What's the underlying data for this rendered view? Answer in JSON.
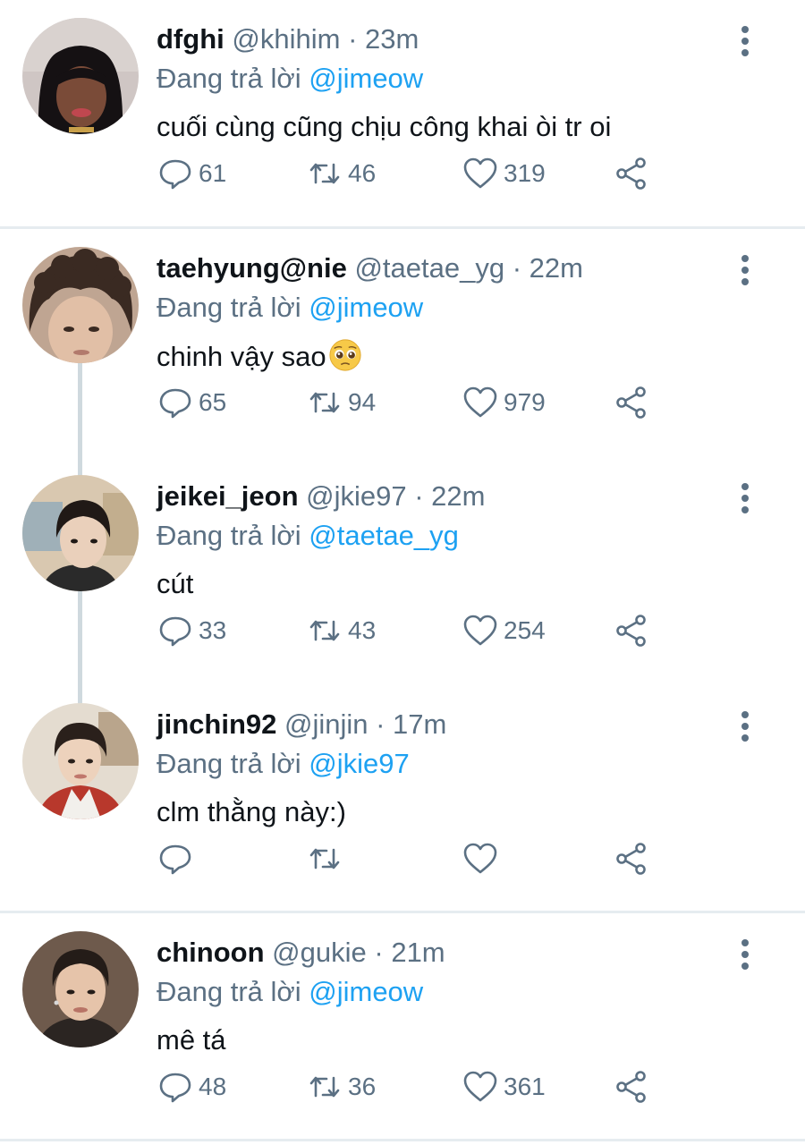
{
  "reply_prefix": "Đang trả lời",
  "colors": {
    "name": "#0f1419",
    "meta": "#5b7083",
    "mention": "#1da1f2",
    "thread_line": "#cfd9de",
    "separator": "#e6ecf0"
  },
  "tweets": [
    {
      "name": "dfghi",
      "handle": "@khihim",
      "time": "· 23m",
      "reply_to": "@jimeow",
      "text": "cuối cùng cũng chịu công khai òi tr oi",
      "replies": "61",
      "retweets": "46",
      "likes": "319"
    },
    {
      "name": "taehyung@nie",
      "handle": "@taetae_yg",
      "time": "· 22m",
      "reply_to": "@jimeow",
      "text": "chinh vậy sao",
      "emoji": "pleading-face-emoji",
      "replies": "65",
      "retweets": "94",
      "likes": "979"
    },
    {
      "name": "jeikei_jeon",
      "handle": "@jkie97",
      "time": "· 22m",
      "reply_to": "@taetae_yg",
      "text": "cút",
      "replies": "33",
      "retweets": "43",
      "likes": "254"
    },
    {
      "name": "jinchin92",
      "handle": "@jinjin",
      "time": "· 17m",
      "reply_to": "@jkie97",
      "text": "clm thằng này:)",
      "replies": "",
      "retweets": "",
      "likes": ""
    },
    {
      "name": "chinoon",
      "handle": "@gukie",
      "time": "· 21m",
      "reply_to": "@jimeow",
      "text": "mê tá",
      "replies": "48",
      "retweets": "36",
      "likes": "361"
    }
  ]
}
